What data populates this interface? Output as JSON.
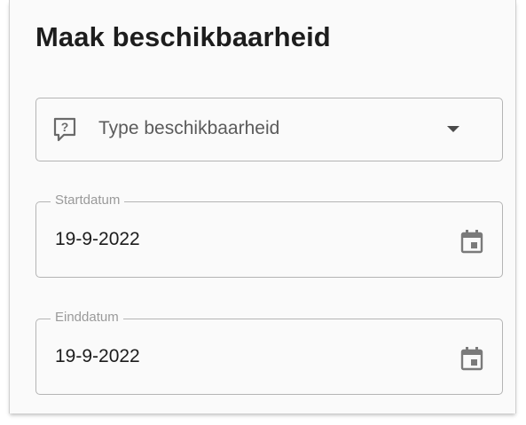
{
  "dialog": {
    "title": "Maak beschikbaarheid"
  },
  "type_select": {
    "icon": "help-chat-icon",
    "placeholder": "Type beschikbaarheid",
    "dropdown_icon": "caret-down-icon"
  },
  "start_date": {
    "label": "Startdatum",
    "value": "19-9-2022",
    "icon": "calendar-icon"
  },
  "end_date": {
    "label": "Einddatum",
    "value": "19-9-2022",
    "icon": "calendar-icon"
  }
}
